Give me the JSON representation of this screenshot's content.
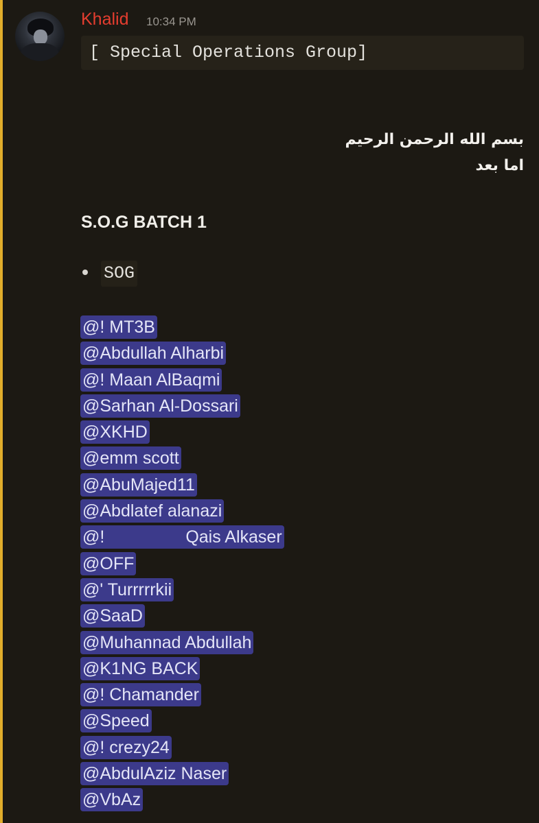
{
  "message": {
    "author": "Khalid",
    "timestamp": "10:34 PM",
    "code_block": "[ Special Operations Group]",
    "arabic_lines": [
      "بسم الله الرحمن الرحيم",
      "اما بعد"
    ],
    "batch_title": "S.O.G BATCH 1",
    "bullet_item": "SOG",
    "mentions": [
      "@! MT3B",
      "@Abdullah Alharbi",
      "@! Maan AlBaqmi",
      "@Sarhan Al-Dossari",
      "@XKHD",
      "@emm scott",
      "@AbuMajed11",
      "@Abdlatef alanazi",
      "@!",
      "@OFF",
      "@' Turrrrrkii",
      "@SaaD",
      "@Muhannad Abdullah",
      "@K1NG BACK",
      "@! Chamander",
      "@Speed",
      "@! crezy24",
      "@AbdulAziz Naser",
      "@VbAz"
    ],
    "mention_9_suffix": "Qais Alkaser"
  },
  "colors": {
    "background": "#1c1913",
    "highlight_bar": "#e1ad2b",
    "author_name": "#e53d2f",
    "mention_bg": "#3c3a8b",
    "mention_text": "#e4e5f7"
  },
  "icons": {
    "avatar": "user-avatar"
  }
}
